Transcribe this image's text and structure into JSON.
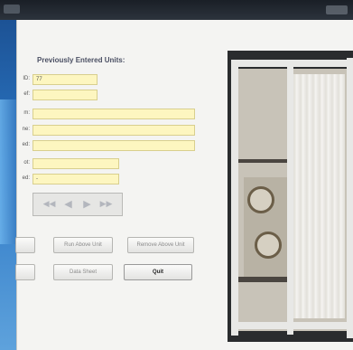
{
  "form": {
    "section_title": "Previously Entered Units:",
    "fields": [
      {
        "label": "ID:",
        "value": "77"
      },
      {
        "label": "ef:",
        "value": ""
      },
      {
        "label": "m:",
        "value": ""
      },
      {
        "label": "ne:",
        "value": ""
      },
      {
        "label": "ed:",
        "value": ""
      },
      {
        "label": "ot:",
        "value": ""
      },
      {
        "label": "ed:",
        "value": "-"
      }
    ]
  },
  "navigation": {
    "first": "◀◀",
    "previous": "◀",
    "next": "▶",
    "last": "▶▶"
  },
  "buttons": {
    "blank_left_1": "",
    "run_above_unit": "Run Above Unit",
    "remove_above_unit": "Remove Above Unit",
    "blank_left_2": "",
    "data_sheet": "Data Sheet",
    "quit": "Quit"
  }
}
